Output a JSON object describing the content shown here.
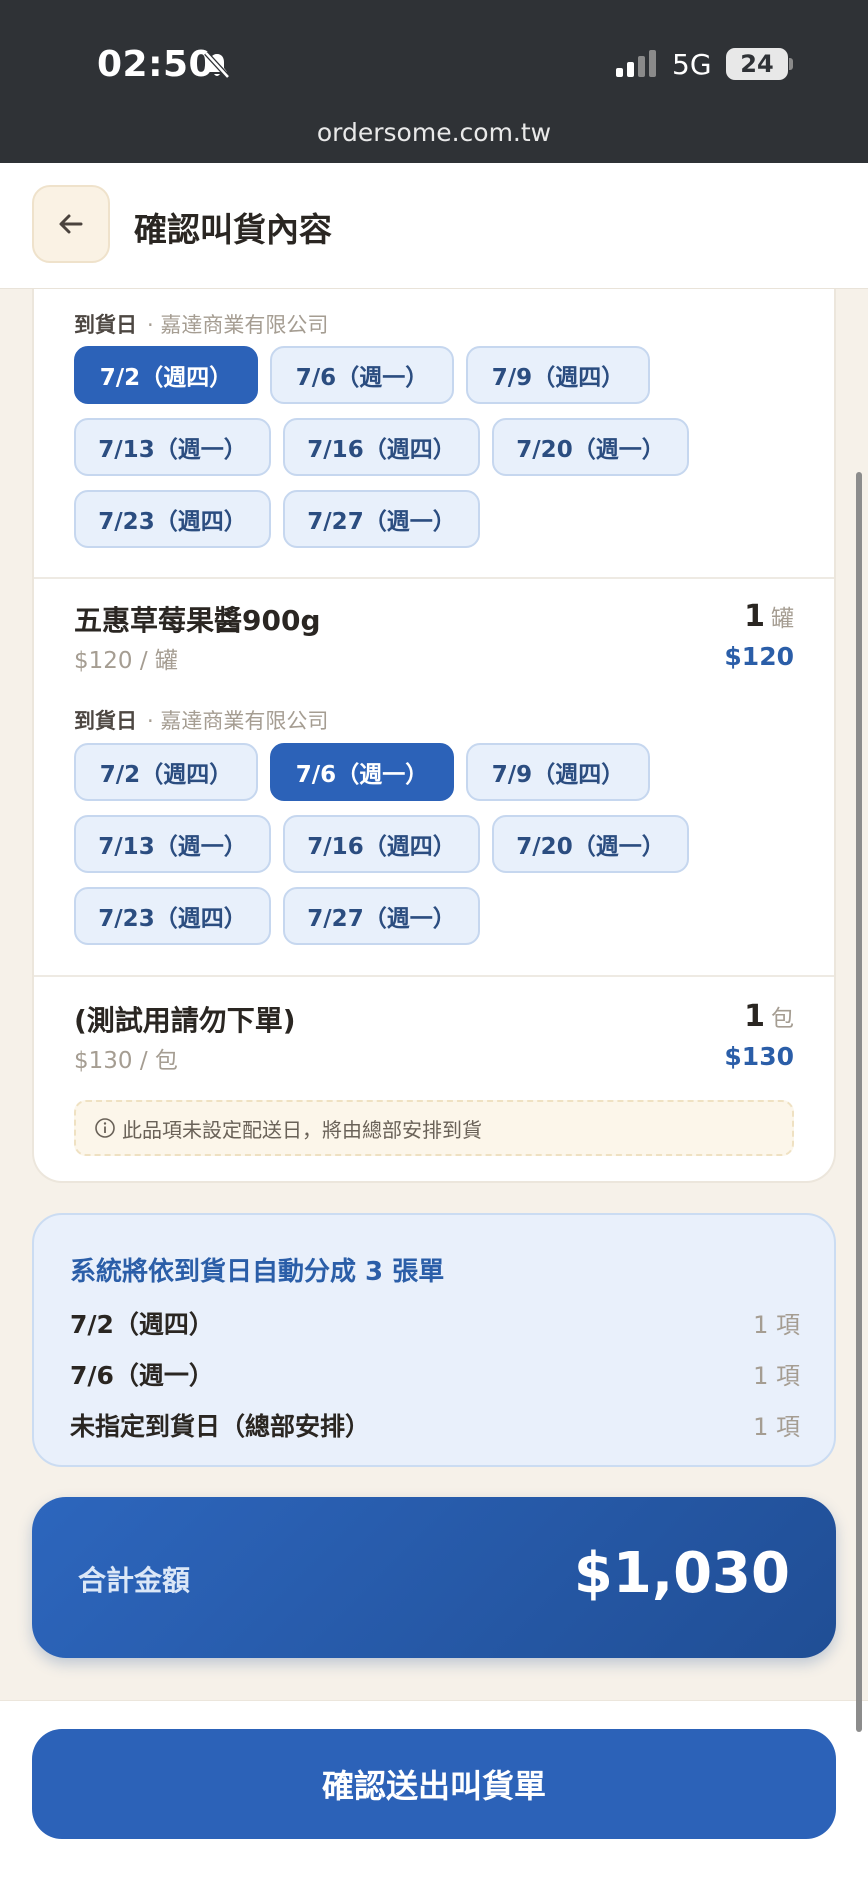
{
  "status_bar": {
    "time": "02:50",
    "network": "5G",
    "battery": "24",
    "url": "ordersome.com.tw"
  },
  "header": {
    "title": "確認叫貨內容"
  },
  "items": [
    {
      "date_label": "到貨日",
      "supplier": "· 嘉達商業有限公司",
      "dates": [
        "7/2（週四）",
        "7/6（週一）",
        "7/9（週四）",
        "7/13（週一）",
        "7/16（週四）",
        "7/20（週一）",
        "7/23（週四）",
        "7/27（週一）"
      ],
      "selected_date": "7/2（週四）"
    },
    {
      "name": "五惠草莓果醬900g",
      "unit_price": "$120 / 罐",
      "qty": "1",
      "unit": "罐",
      "total": "$120",
      "date_label": "到貨日",
      "supplier": "· 嘉達商業有限公司",
      "dates": [
        "7/2（週四）",
        "7/6（週一）",
        "7/9（週四）",
        "7/13（週一）",
        "7/16（週四）",
        "7/20（週一）",
        "7/23（週四）",
        "7/27（週一）"
      ],
      "selected_date": "7/6（週一）"
    },
    {
      "name": "(測試用請勿下單)",
      "unit_price": "$130 / 包",
      "qty": "1",
      "unit": "包",
      "total": "$130",
      "notice": "此品項未設定配送日，將由總部安排到貨"
    }
  ],
  "split": {
    "title": "系統將依到貨日自動分成 3 張單",
    "rows": [
      {
        "date": "7/2（週四）",
        "count": "1 項"
      },
      {
        "date": "7/6（週一）",
        "count": "1 項"
      },
      {
        "date": "未指定到貨日（總部安排）",
        "count": "1 項"
      }
    ]
  },
  "total": {
    "label": "合計金額",
    "value": "$1,030"
  },
  "footer": {
    "submit_label": "確認送出叫貨單"
  },
  "colors": {
    "primary": "#2c62b8",
    "chip_bg": "#e8f0fb",
    "price": "#2b5ea8",
    "background": "#f6f1e9"
  }
}
